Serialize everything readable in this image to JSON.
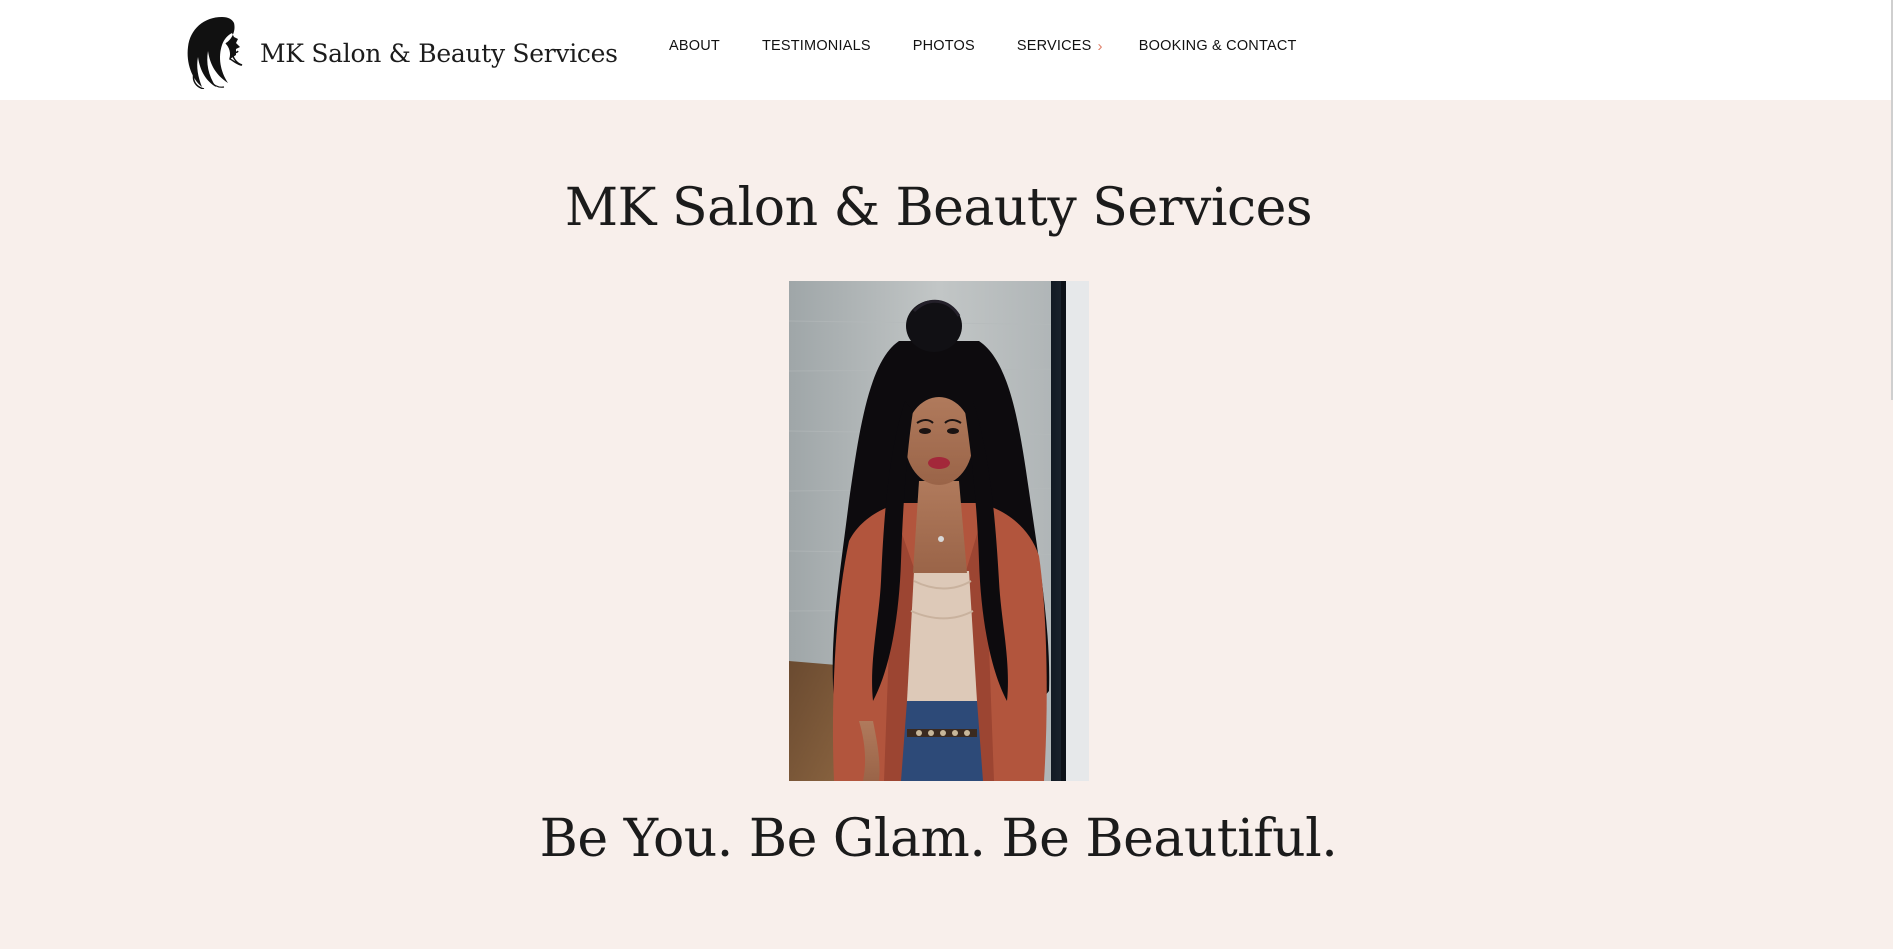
{
  "header": {
    "logo_text": "MK Salon & Beauty Services",
    "logo_icon": "woman-silhouette-logo",
    "nav": [
      {
        "label": "ABOUT"
      },
      {
        "label": "TESTIMONIALS"
      },
      {
        "label": "PHOTOS"
      },
      {
        "label": "SERVICES",
        "submenu_icon": "chevron-right-icon"
      },
      {
        "label": "BOOKING & CONTACT"
      }
    ]
  },
  "hero": {
    "title": "MK Salon & Beauty Services",
    "tagline": "Be You. Be Glam. Be Beautiful."
  },
  "colors": {
    "hero_background": "#f8efeb",
    "header_background": "#ffffff",
    "text": "#1b1b1b",
    "accent": "#e0806a"
  }
}
